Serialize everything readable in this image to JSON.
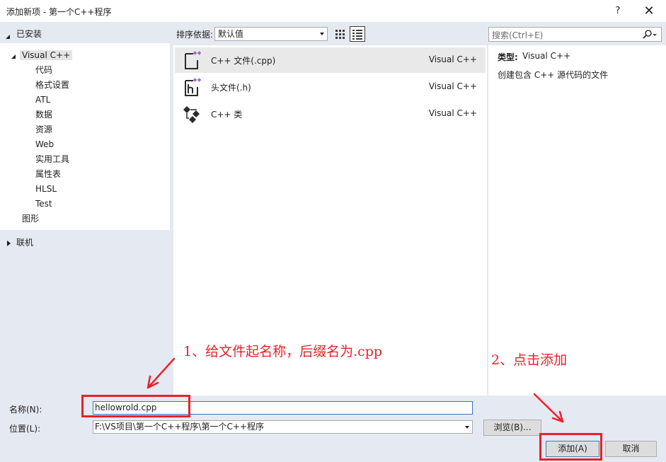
{
  "window": {
    "title": "添加新项 - 第一个C++程序",
    "help_label": "?",
    "close_label": "✕"
  },
  "left_pane": {
    "installed_label": "已安装",
    "tree_root": "Visual C++",
    "tree_children": [
      "代码",
      "格式设置",
      "ATL",
      "数据",
      "资源",
      "Web",
      "实用工具",
      "属性表",
      "HLSL",
      "Test"
    ],
    "tree_sibling": "图形",
    "online_label": "联机"
  },
  "toolbar": {
    "sort_label": "排序依据:",
    "sort_value": "默认值"
  },
  "templates": [
    {
      "name": "C++ 文件(.cpp)",
      "lang": "Visual C++",
      "icon": "cpp-file-icon",
      "selected": true
    },
    {
      "name": "头文件(.h)",
      "lang": "Visual C++",
      "icon": "header-file-icon",
      "selected": false
    },
    {
      "name": "C++ 类",
      "lang": "Visual C++",
      "icon": "cpp-class-icon",
      "selected": false
    }
  ],
  "search": {
    "placeholder": "搜索(Ctrl+E)"
  },
  "details": {
    "type_label": "类型:",
    "type_value": "Visual C++",
    "description": "创建包含 C++ 源代码的文件"
  },
  "form": {
    "name_label": "名称(N):",
    "name_value": "hellowrold.cpp",
    "location_label": "位置(L):",
    "location_value": "F:\\VS项目\\第一个C++程序\\第一个C++程序",
    "browse_label": "浏览(B)...",
    "add_label": "添加(A)",
    "cancel_label": "取消"
  },
  "annotations": {
    "step1": "1、给文件起名称，后缀名为.cpp",
    "step2": "2、点击添加",
    "color": "#e8212b"
  }
}
